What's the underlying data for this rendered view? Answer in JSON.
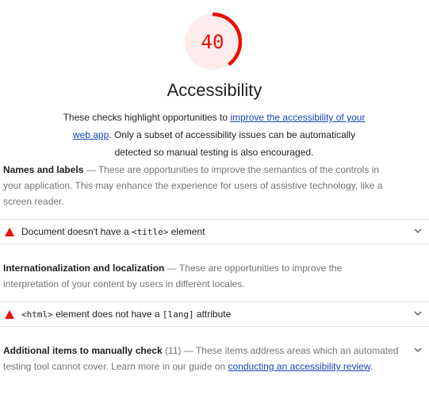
{
  "score": {
    "value": "40",
    "fraction": 0.4,
    "color": "#eb0f00",
    "bg_color": "#fdeceb"
  },
  "title": "Accessibility",
  "description": {
    "prefix": "These checks highlight opportunities to ",
    "link": "improve the accessibility of your web app",
    "suffix": ". Only a subset of accessibility issues can be automatically detected so manual testing is also encouraged."
  },
  "groups": [
    {
      "title": "Names and labels",
      "sep": " — ",
      "text": "These are opportunities to improve the semantics of the controls in your application. This may enhance the experience for users of assistive technology, like a screen reader.",
      "audit": {
        "before": "Document doesn't have a ",
        "code": "<title>",
        "after": " element",
        "icon": "warning-triangle-icon"
      }
    },
    {
      "title": "Internationalization and localization",
      "sep": " — ",
      "text": "These are opportunities to improve the interpretation of your content by users in different locales.",
      "audit": {
        "code1": "<html>",
        "mid": " element does not have a ",
        "code2": "[lang]",
        "after": " attribute",
        "icon": "warning-triangle-icon"
      }
    }
  ],
  "manual": {
    "title": "Additional items to manually check",
    "count": " (11)",
    "sep": " — ",
    "text": "These items address areas which an automated testing tool cannot cover. Learn more in our guide on ",
    "link": "conducting an accessibility review",
    "end": "."
  },
  "colors": {
    "fail": "#eb0f00",
    "link": "#1a44b8",
    "muted": "#757575"
  }
}
